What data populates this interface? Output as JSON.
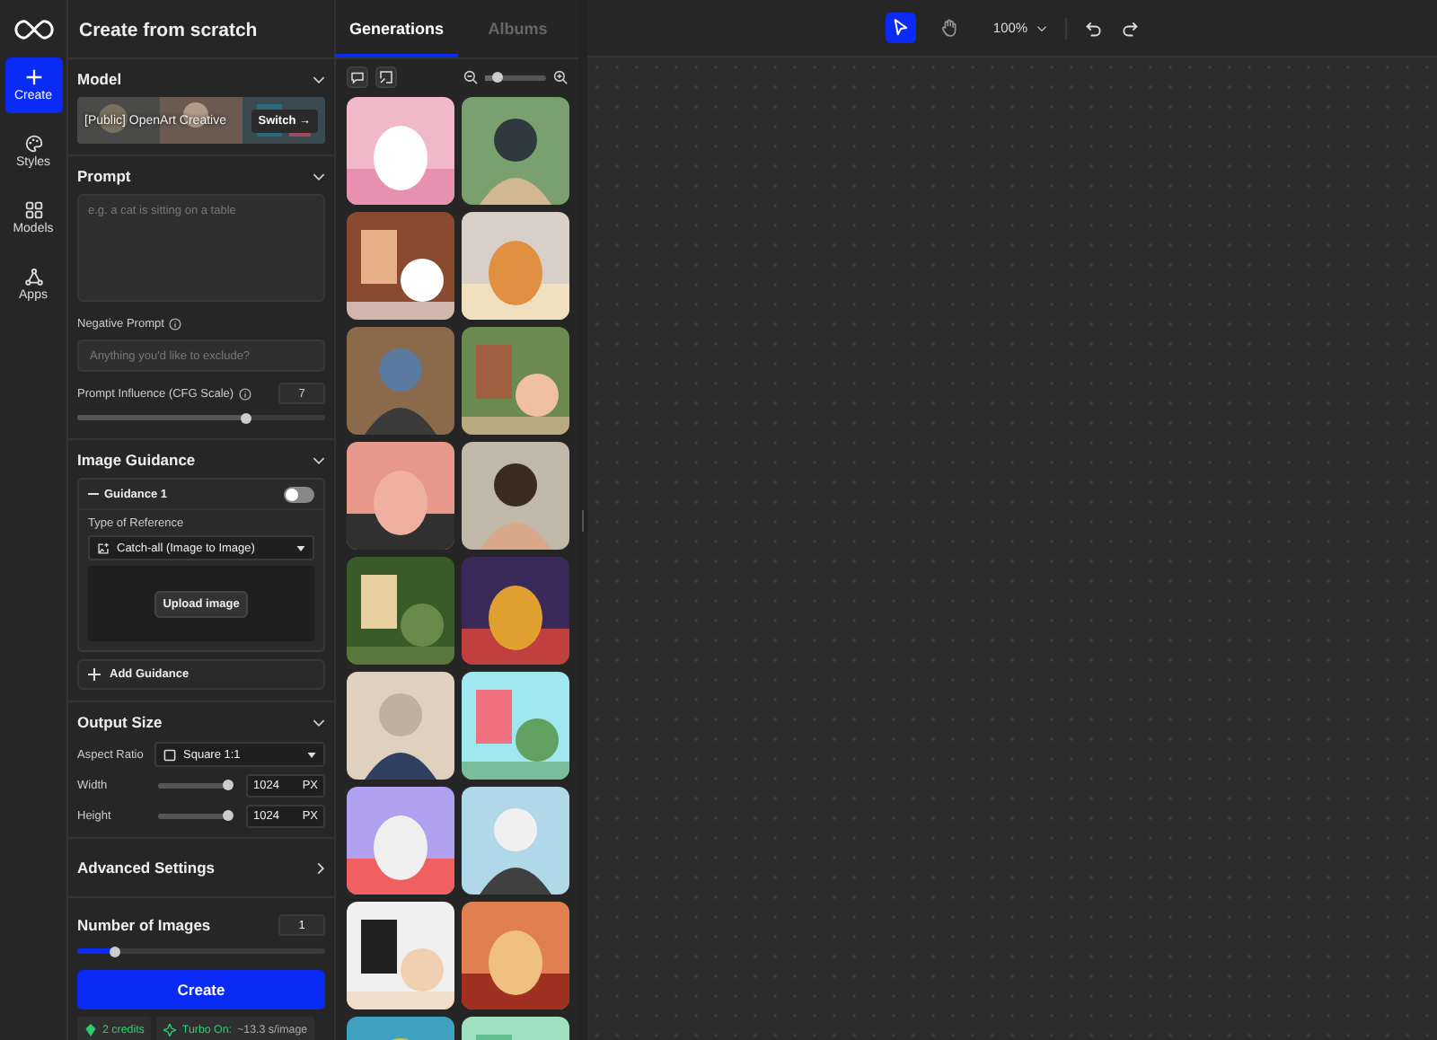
{
  "nav": {
    "items": [
      {
        "kind": "create",
        "label": "Create",
        "selected": true
      },
      {
        "kind": "styles",
        "label": "Styles",
        "selected": false
      },
      {
        "kind": "models",
        "label": "Models",
        "selected": false
      },
      {
        "kind": "apps",
        "label": "Apps",
        "selected": false
      }
    ]
  },
  "panel": {
    "title": "Create from scratch",
    "model": {
      "heading": "Model",
      "name": "[Public] OpenArt Creative",
      "switch": "Switch →"
    },
    "prompt": {
      "heading": "Prompt",
      "placeholder": "e.g. a cat is sitting on a table",
      "negative_label": "Negative Prompt",
      "negative_placeholder": "Anything you'd like to exclude?",
      "cfg_label": "Prompt Influence (CFG Scale)",
      "cfg_value": "7",
      "cfg": {
        "level": 0.68
      }
    },
    "guidance": {
      "heading": "Image Guidance",
      "item_title": "Guidance 1",
      "on": false,
      "type_label": "Type of Reference",
      "type_value": "Catch-all (Image to Image)",
      "upload": "Upload image",
      "add": "Add Guidance"
    },
    "output": {
      "heading": "Output Size",
      "aspect_label": "Aspect Ratio",
      "aspect_value": "Square 1:1",
      "dims": [
        {
          "label": "Width",
          "level": 0.97,
          "value": "1024",
          "unit": "PX"
        },
        {
          "label": "Height",
          "level": 0.97,
          "value": "1024",
          "unit": "PX"
        }
      ]
    },
    "advanced": {
      "heading": "Advanced Settings"
    },
    "images": {
      "heading": "Number of Images",
      "value": "1",
      "level": 0.15
    },
    "create": "Create",
    "credits": "2 credits",
    "turbo_label": "Turbo On:",
    "turbo_value": "~13.3 s/image"
  },
  "gallery": {
    "tabs": [
      {
        "label": "Generations",
        "selected": true
      },
      {
        "label": "Albums",
        "selected": false
      }
    ],
    "zoom": {
      "level": 0.2
    }
  },
  "canvas": {
    "tools": [
      {
        "kind": "select",
        "selected": true
      },
      {
        "kind": "hand",
        "selected": false
      }
    ],
    "zoom": "100%"
  }
}
